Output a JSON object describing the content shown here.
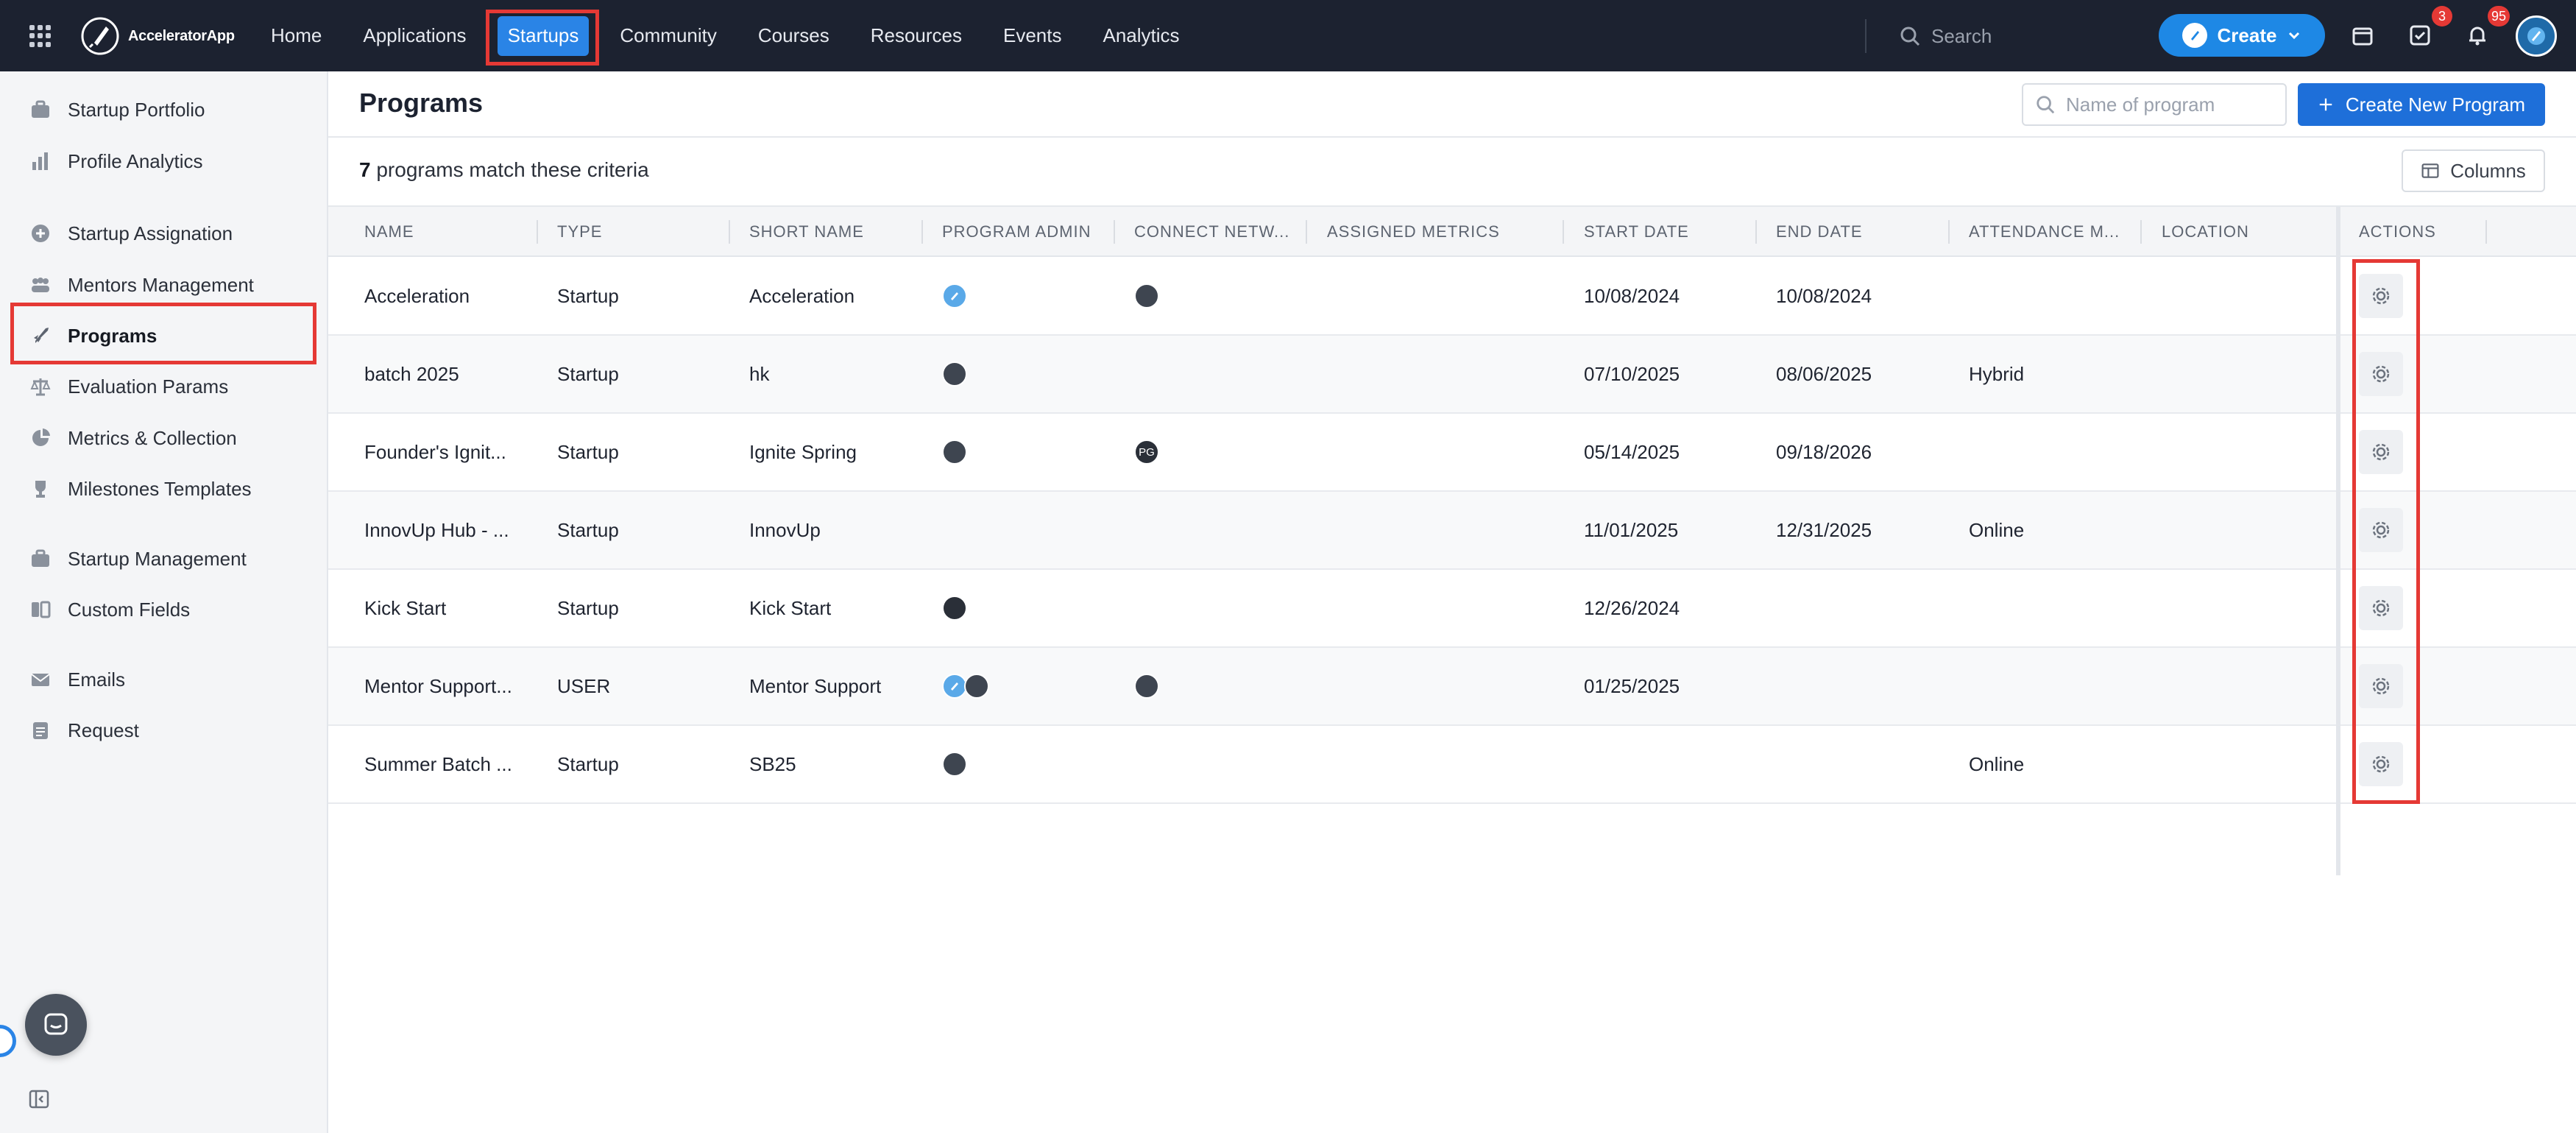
{
  "app": {
    "name": "AcceleratorApp"
  },
  "topnav": {
    "items": [
      {
        "label": "Home"
      },
      {
        "label": "Applications"
      },
      {
        "label": "Startups",
        "active": true
      },
      {
        "label": "Community"
      },
      {
        "label": "Courses"
      },
      {
        "label": "Resources"
      },
      {
        "label": "Events"
      },
      {
        "label": "Analytics"
      }
    ],
    "search_placeholder": "Search",
    "create_label": "Create",
    "tasks_badge": "3",
    "notifications_badge": "95"
  },
  "sidebar": {
    "items": [
      {
        "label": "Startup Portfolio",
        "icon": "briefcase-icon"
      },
      {
        "label": "Profile Analytics",
        "icon": "bar-chart-icon"
      },
      {
        "label": "Startup Assignation",
        "icon": "plus-circle-icon"
      },
      {
        "label": "Mentors Management",
        "icon": "users-icon"
      },
      {
        "label": "Programs",
        "icon": "rocket-icon",
        "active": true
      },
      {
        "label": "Evaluation Params",
        "icon": "scale-icon"
      },
      {
        "label": "Metrics & Collection",
        "icon": "pie-chart-icon"
      },
      {
        "label": "Milestones Templates",
        "icon": "trophy-icon"
      },
      {
        "label": "Startup Management",
        "icon": "briefcase-icon"
      },
      {
        "label": "Custom Fields",
        "icon": "custom-fields-icon"
      },
      {
        "label": "Emails",
        "icon": "mail-icon"
      },
      {
        "label": "Request",
        "icon": "clipboard-icon"
      }
    ]
  },
  "main": {
    "title": "Programs",
    "filter_placeholder": "Name of program",
    "create_button": "Create New Program",
    "match_count": "7",
    "match_text": "programs match these criteria",
    "columns_button": "Columns",
    "headers": [
      "NAME",
      "TYPE",
      "SHORT NAME",
      "PROGRAM ADMIN",
      "CONNECT NETW...",
      "ASSIGNED METRICS",
      "START DATE",
      "END DATE",
      "ATTENDANCE M...",
      "LOCATION",
      "ACTIONS"
    ],
    "rows": [
      {
        "name": "Acceleration",
        "type": "Startup",
        "short": "Acceleration",
        "admins": [
          "logo"
        ],
        "network": [
          "photo"
        ],
        "start": "10/08/2024",
        "end": "10/08/2024",
        "attendance": ""
      },
      {
        "name": "batch 2025",
        "type": "Startup",
        "short": "hk",
        "admins": [
          "photo"
        ],
        "network": [],
        "start": "07/10/2025",
        "end": "08/06/2025",
        "attendance": "Hybrid"
      },
      {
        "name": "Founder's Ignit...",
        "type": "Startup",
        "short": "Ignite Spring",
        "admins": [
          "photo"
        ],
        "network": [
          "PG"
        ],
        "start": "05/14/2025",
        "end": "09/18/2026",
        "attendance": ""
      },
      {
        "name": "InnovUp Hub - ...",
        "type": "Startup",
        "short": "InnovUp",
        "admins": [],
        "network": [],
        "start": "11/01/2025",
        "end": "12/31/2025",
        "attendance": "Online"
      },
      {
        "name": "Kick Start",
        "type": "Startup",
        "short": "Kick Start",
        "admins": [
          "photo"
        ],
        "network": [],
        "start": "12/26/2024",
        "end": "",
        "attendance": ""
      },
      {
        "name": "Mentor Support...",
        "type": "USER",
        "short": "Mentor Support",
        "admins": [
          "logo",
          "photo"
        ],
        "network": [
          "photo"
        ],
        "start": "01/25/2025",
        "end": "",
        "attendance": ""
      },
      {
        "name": "Summer Batch ...",
        "type": "Startup",
        "short": "SB25",
        "admins": [
          "photo"
        ],
        "network": [],
        "start": "",
        "end": "",
        "attendance": "Online"
      }
    ]
  },
  "colors": {
    "topbar": "#1c2230",
    "accent": "#1e88e5",
    "highlight": "#e53935"
  }
}
